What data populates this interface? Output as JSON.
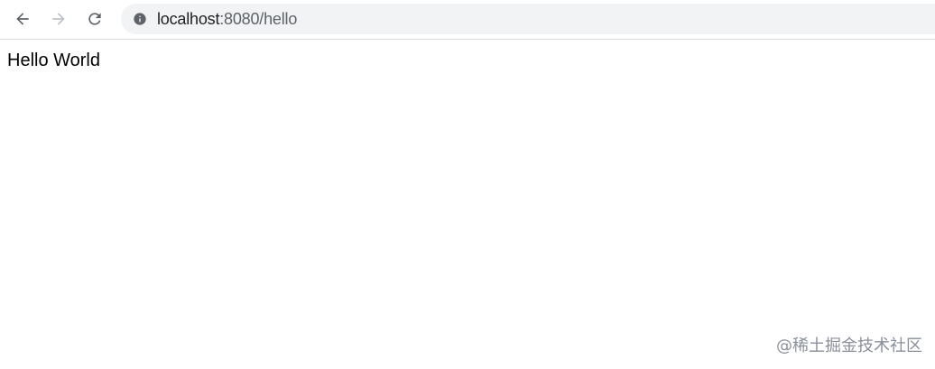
{
  "browser": {
    "nav": {
      "back_icon": "arrow-left-icon",
      "forward_icon": "arrow-right-icon",
      "reload_icon": "reload-icon"
    },
    "address_bar": {
      "security_icon": "info-icon",
      "host": "localhost",
      "path": ":8080/hello"
    }
  },
  "page": {
    "text": "Hello World"
  },
  "watermark": {
    "text": "@稀土掘金技术社区"
  },
  "colors": {
    "toolbar_border": "#dadce0",
    "omnibox_bg": "#f1f3f4",
    "icon_active": "#5f6368",
    "icon_disabled": "#bdc1c6",
    "watermark": "#8a8f99"
  }
}
